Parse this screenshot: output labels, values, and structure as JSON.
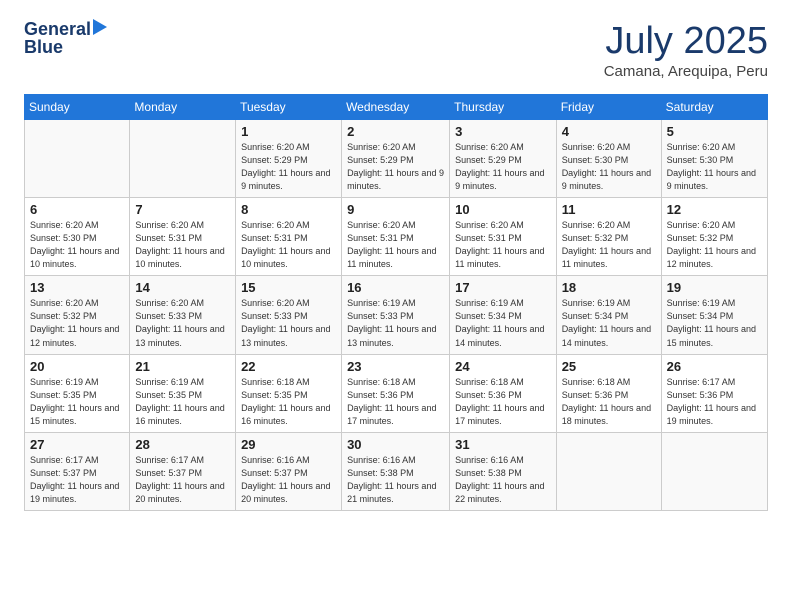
{
  "header": {
    "logo_line1": "General",
    "logo_line2": "Blue",
    "month_year": "July 2025",
    "location": "Camana, Arequipa, Peru"
  },
  "days_of_week": [
    "Sunday",
    "Monday",
    "Tuesday",
    "Wednesday",
    "Thursday",
    "Friday",
    "Saturday"
  ],
  "weeks": [
    [
      {
        "day": "",
        "sunrise": "",
        "sunset": "",
        "daylight": ""
      },
      {
        "day": "",
        "sunrise": "",
        "sunset": "",
        "daylight": ""
      },
      {
        "day": "1",
        "sunrise": "Sunrise: 6:20 AM",
        "sunset": "Sunset: 5:29 PM",
        "daylight": "Daylight: 11 hours and 9 minutes."
      },
      {
        "day": "2",
        "sunrise": "Sunrise: 6:20 AM",
        "sunset": "Sunset: 5:29 PM",
        "daylight": "Daylight: 11 hours and 9 minutes."
      },
      {
        "day": "3",
        "sunrise": "Sunrise: 6:20 AM",
        "sunset": "Sunset: 5:29 PM",
        "daylight": "Daylight: 11 hours and 9 minutes."
      },
      {
        "day": "4",
        "sunrise": "Sunrise: 6:20 AM",
        "sunset": "Sunset: 5:30 PM",
        "daylight": "Daylight: 11 hours and 9 minutes."
      },
      {
        "day": "5",
        "sunrise": "Sunrise: 6:20 AM",
        "sunset": "Sunset: 5:30 PM",
        "daylight": "Daylight: 11 hours and 9 minutes."
      }
    ],
    [
      {
        "day": "6",
        "sunrise": "Sunrise: 6:20 AM",
        "sunset": "Sunset: 5:30 PM",
        "daylight": "Daylight: 11 hours and 10 minutes."
      },
      {
        "day": "7",
        "sunrise": "Sunrise: 6:20 AM",
        "sunset": "Sunset: 5:31 PM",
        "daylight": "Daylight: 11 hours and 10 minutes."
      },
      {
        "day": "8",
        "sunrise": "Sunrise: 6:20 AM",
        "sunset": "Sunset: 5:31 PM",
        "daylight": "Daylight: 11 hours and 10 minutes."
      },
      {
        "day": "9",
        "sunrise": "Sunrise: 6:20 AM",
        "sunset": "Sunset: 5:31 PM",
        "daylight": "Daylight: 11 hours and 11 minutes."
      },
      {
        "day": "10",
        "sunrise": "Sunrise: 6:20 AM",
        "sunset": "Sunset: 5:31 PM",
        "daylight": "Daylight: 11 hours and 11 minutes."
      },
      {
        "day": "11",
        "sunrise": "Sunrise: 6:20 AM",
        "sunset": "Sunset: 5:32 PM",
        "daylight": "Daylight: 11 hours and 11 minutes."
      },
      {
        "day": "12",
        "sunrise": "Sunrise: 6:20 AM",
        "sunset": "Sunset: 5:32 PM",
        "daylight": "Daylight: 11 hours and 12 minutes."
      }
    ],
    [
      {
        "day": "13",
        "sunrise": "Sunrise: 6:20 AM",
        "sunset": "Sunset: 5:32 PM",
        "daylight": "Daylight: 11 hours and 12 minutes."
      },
      {
        "day": "14",
        "sunrise": "Sunrise: 6:20 AM",
        "sunset": "Sunset: 5:33 PM",
        "daylight": "Daylight: 11 hours and 13 minutes."
      },
      {
        "day": "15",
        "sunrise": "Sunrise: 6:20 AM",
        "sunset": "Sunset: 5:33 PM",
        "daylight": "Daylight: 11 hours and 13 minutes."
      },
      {
        "day": "16",
        "sunrise": "Sunrise: 6:19 AM",
        "sunset": "Sunset: 5:33 PM",
        "daylight": "Daylight: 11 hours and 13 minutes."
      },
      {
        "day": "17",
        "sunrise": "Sunrise: 6:19 AM",
        "sunset": "Sunset: 5:34 PM",
        "daylight": "Daylight: 11 hours and 14 minutes."
      },
      {
        "day": "18",
        "sunrise": "Sunrise: 6:19 AM",
        "sunset": "Sunset: 5:34 PM",
        "daylight": "Daylight: 11 hours and 14 minutes."
      },
      {
        "day": "19",
        "sunrise": "Sunrise: 6:19 AM",
        "sunset": "Sunset: 5:34 PM",
        "daylight": "Daylight: 11 hours and 15 minutes."
      }
    ],
    [
      {
        "day": "20",
        "sunrise": "Sunrise: 6:19 AM",
        "sunset": "Sunset: 5:35 PM",
        "daylight": "Daylight: 11 hours and 15 minutes."
      },
      {
        "day": "21",
        "sunrise": "Sunrise: 6:19 AM",
        "sunset": "Sunset: 5:35 PM",
        "daylight": "Daylight: 11 hours and 16 minutes."
      },
      {
        "day": "22",
        "sunrise": "Sunrise: 6:18 AM",
        "sunset": "Sunset: 5:35 PM",
        "daylight": "Daylight: 11 hours and 16 minutes."
      },
      {
        "day": "23",
        "sunrise": "Sunrise: 6:18 AM",
        "sunset": "Sunset: 5:36 PM",
        "daylight": "Daylight: 11 hours and 17 minutes."
      },
      {
        "day": "24",
        "sunrise": "Sunrise: 6:18 AM",
        "sunset": "Sunset: 5:36 PM",
        "daylight": "Daylight: 11 hours and 17 minutes."
      },
      {
        "day": "25",
        "sunrise": "Sunrise: 6:18 AM",
        "sunset": "Sunset: 5:36 PM",
        "daylight": "Daylight: 11 hours and 18 minutes."
      },
      {
        "day": "26",
        "sunrise": "Sunrise: 6:17 AM",
        "sunset": "Sunset: 5:36 PM",
        "daylight": "Daylight: 11 hours and 19 minutes."
      }
    ],
    [
      {
        "day": "27",
        "sunrise": "Sunrise: 6:17 AM",
        "sunset": "Sunset: 5:37 PM",
        "daylight": "Daylight: 11 hours and 19 minutes."
      },
      {
        "day": "28",
        "sunrise": "Sunrise: 6:17 AM",
        "sunset": "Sunset: 5:37 PM",
        "daylight": "Daylight: 11 hours and 20 minutes."
      },
      {
        "day": "29",
        "sunrise": "Sunrise: 6:16 AM",
        "sunset": "Sunset: 5:37 PM",
        "daylight": "Daylight: 11 hours and 20 minutes."
      },
      {
        "day": "30",
        "sunrise": "Sunrise: 6:16 AM",
        "sunset": "Sunset: 5:38 PM",
        "daylight": "Daylight: 11 hours and 21 minutes."
      },
      {
        "day": "31",
        "sunrise": "Sunrise: 6:16 AM",
        "sunset": "Sunset: 5:38 PM",
        "daylight": "Daylight: 11 hours and 22 minutes."
      },
      {
        "day": "",
        "sunrise": "",
        "sunset": "",
        "daylight": ""
      },
      {
        "day": "",
        "sunrise": "",
        "sunset": "",
        "daylight": ""
      }
    ]
  ]
}
